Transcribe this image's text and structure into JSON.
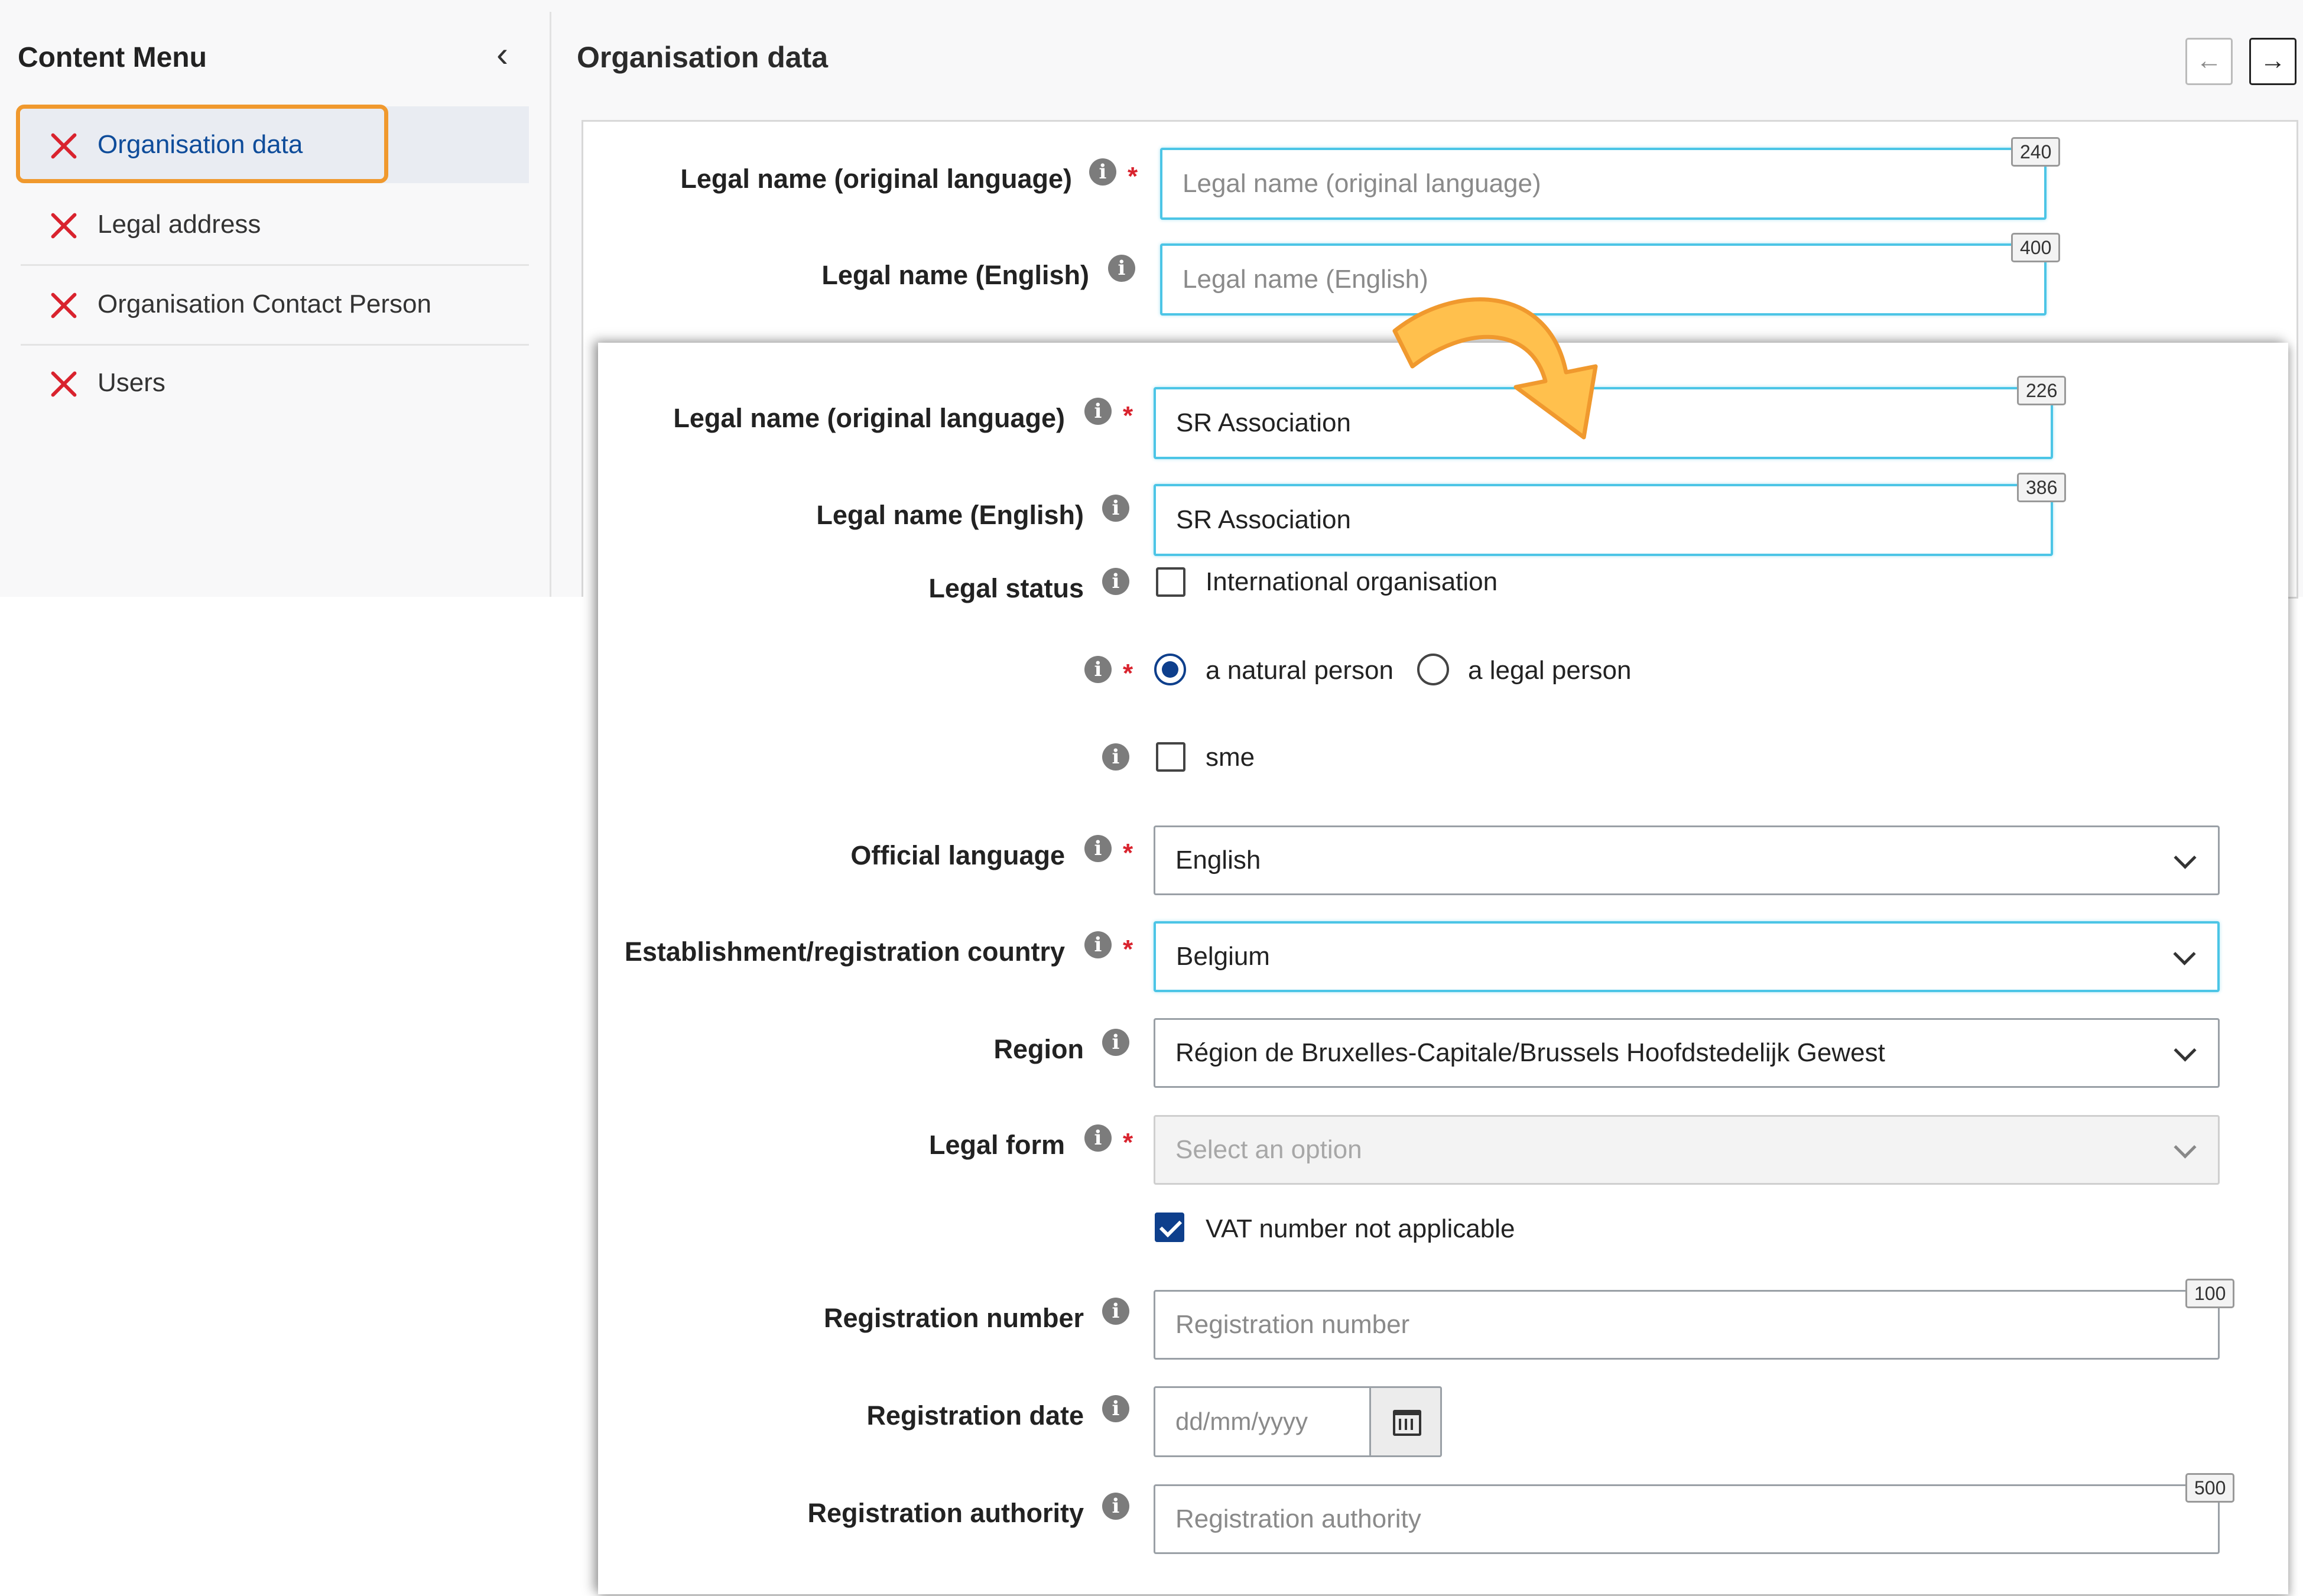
{
  "sidebar": {
    "title": "Content Menu",
    "items": [
      {
        "label": "Organisation data",
        "icon": "error-x-icon"
      },
      {
        "label": "Legal address",
        "icon": "error-x-icon"
      },
      {
        "label": "Organisation Contact Person",
        "icon": "error-x-icon"
      },
      {
        "label": "Users",
        "icon": "error-x-icon"
      }
    ]
  },
  "page": {
    "title": "Organisation data",
    "prev_icon": "←",
    "next_icon": "→"
  },
  "top_form": {
    "legal_name_original": {
      "label": "Legal name (original language)",
      "placeholder": "Legal name (original language)",
      "counter": "240"
    },
    "legal_name_english": {
      "label": "Legal name (English)",
      "placeholder": "Legal name (English)",
      "counter": "400"
    }
  },
  "form": {
    "legal_name_original": {
      "label": "Legal name (original language)",
      "value": "SR Association",
      "counter": "226"
    },
    "legal_name_english": {
      "label": "Legal name (English)",
      "value": "SR Association",
      "counter": "386"
    },
    "legal_status": {
      "label": "Legal status",
      "option": "International organisation",
      "checked": false
    },
    "person_type": {
      "options": [
        "a natural person",
        "a legal person"
      ],
      "selected": "a natural person"
    },
    "sme": {
      "option": "sme",
      "checked": false
    },
    "official_language": {
      "label": "Official language",
      "value": "English"
    },
    "country": {
      "label": "Establishment/registration country",
      "value": "Belgium"
    },
    "region": {
      "label": "Region",
      "value": "Région de Bruxelles-Capitale/Brussels Hoofdstedelijk Gewest"
    },
    "legal_form": {
      "label": "Legal form",
      "placeholder": "Select an option"
    },
    "vat": {
      "option": "VAT number not applicable",
      "checked": true
    },
    "registration_number": {
      "label": "Registration number",
      "placeholder": "Registration number",
      "counter": "100"
    },
    "registration_date": {
      "label": "Registration date",
      "placeholder": "dd/mm/yyyy"
    },
    "registration_authority": {
      "label": "Registration authority",
      "placeholder": "Registration authority",
      "counter": "500"
    }
  },
  "info_glyph": "i",
  "required_mark": "*",
  "colors": {
    "accent_blue": "#0e3f8c",
    "error_red": "#d9232e",
    "highlight_orange": "#f0992e",
    "focus_cyan": "#4cc5e6",
    "arrow_yellow": "#ffc04d"
  }
}
